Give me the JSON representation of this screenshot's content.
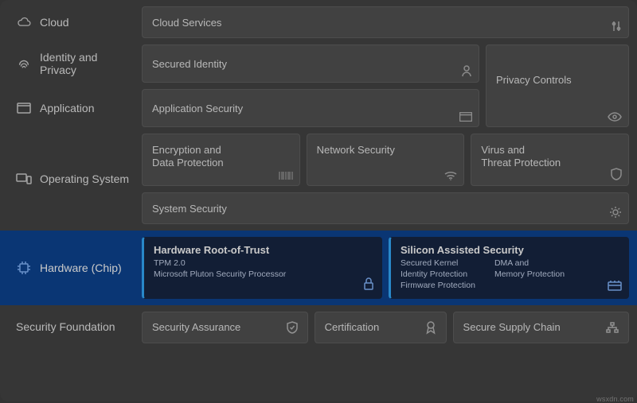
{
  "rows": {
    "cloud": {
      "label": "Cloud",
      "card": "Cloud Services"
    },
    "identity": {
      "label": "Identity and Privacy",
      "secured_identity": "Secured Identity",
      "privacy_controls": "Privacy Controls"
    },
    "application": {
      "label": "Application",
      "card": "Application Security"
    },
    "os": {
      "label": "Operating System",
      "encryption": "Encryption and\nData Protection",
      "network": "Network Security",
      "virus": "Virus and\nThreat Protection",
      "system": "System Security"
    },
    "hardware": {
      "label": "Hardware (Chip)",
      "root": {
        "title": "Hardware Root-of-Trust",
        "l1": "TPM 2.0",
        "l2": "Microsoft Pluton Security Processor"
      },
      "silicon": {
        "title": "Silicon Assisted Security",
        "c1a": "Secured Kernel",
        "c1b": "Identity Protection",
        "c1c": "Firmware Protection",
        "c2a": "DMA and",
        "c2b": "Memory Protection"
      }
    },
    "foundation": {
      "label": "Security Foundation",
      "assurance": "Security Assurance",
      "cert": "Certification",
      "supply": "Secure Supply Chain"
    }
  },
  "watermark": "wsxdn.com"
}
